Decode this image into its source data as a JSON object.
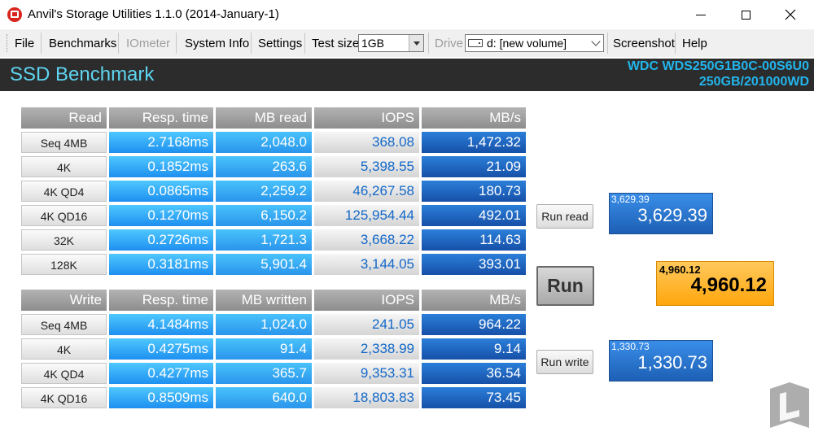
{
  "window": {
    "title": "Anvil's Storage Utilities 1.1.0 (2014-January-1)"
  },
  "menu": {
    "file": "File",
    "benchmarks": "Benchmarks",
    "iometer": "IOmeter",
    "system_info": "System Info",
    "settings": "Settings",
    "test_size_label": "Test size",
    "test_size_value": "1GB",
    "drive_label": "Drive",
    "drive_value": "d: [new volume]",
    "screenshot": "Screenshot",
    "help": "Help"
  },
  "header": {
    "title": "SSD Benchmark",
    "drive_model": "WDC WDS250G1B0C-00S6U0",
    "drive_size": "250GB/201000WD"
  },
  "read_table": {
    "headers": [
      "Read",
      "Resp. time",
      "MB read",
      "IOPS",
      "MB/s"
    ],
    "rows": [
      {
        "label": "Seq 4MB",
        "resp": "2.7168ms",
        "mb": "2,048.0",
        "iops": "368.08",
        "mbs": "1,472.32"
      },
      {
        "label": "4K",
        "resp": "0.1852ms",
        "mb": "263.6",
        "iops": "5,398.55",
        "mbs": "21.09"
      },
      {
        "label": "4K QD4",
        "resp": "0.0865ms",
        "mb": "2,259.2",
        "iops": "46,267.58",
        "mbs": "180.73"
      },
      {
        "label": "4K QD16",
        "resp": "0.1270ms",
        "mb": "6,150.2",
        "iops": "125,954.44",
        "mbs": "492.01"
      },
      {
        "label": "32K",
        "resp": "0.2726ms",
        "mb": "1,721.3",
        "iops": "3,668.22",
        "mbs": "114.63"
      },
      {
        "label": "128K",
        "resp": "0.3181ms",
        "mb": "5,901.4",
        "iops": "3,144.05",
        "mbs": "393.01"
      }
    ]
  },
  "write_table": {
    "headers": [
      "Write",
      "Resp. time",
      "MB written",
      "IOPS",
      "MB/s"
    ],
    "rows": [
      {
        "label": "Seq 4MB",
        "resp": "4.1484ms",
        "mb": "1,024.0",
        "iops": "241.05",
        "mbs": "964.22"
      },
      {
        "label": "4K",
        "resp": "0.4275ms",
        "mb": "91.4",
        "iops": "2,338.99",
        "mbs": "9.14"
      },
      {
        "label": "4K QD4",
        "resp": "0.4277ms",
        "mb": "365.7",
        "iops": "9,353.31",
        "mbs": "36.54"
      },
      {
        "label": "4K QD16",
        "resp": "0.8509ms",
        "mb": "640.0",
        "iops": "18,803.83",
        "mbs": "73.45"
      }
    ]
  },
  "buttons": {
    "run_read": "Run read",
    "run": "Run",
    "run_write": "Run write"
  },
  "scores": {
    "read_small": "3,629.39",
    "read_big": "3,629.39",
    "total_small": "4,960.12",
    "total_big": "4,960.12",
    "write_small": "1,330.73",
    "write_big": "1,330.73"
  },
  "icons": {
    "app": "app-icon",
    "minimize": "minimize-icon",
    "maximize": "maximize-icon",
    "close": "close-icon",
    "drive": "drive-icon",
    "watermark": "legit-reviews-logo"
  },
  "colors": {
    "header_bg": "#2c2c2c",
    "header_title": "#5fd4f0",
    "drive_info": "#22b5ec",
    "resp_cell": "#1e8ff0",
    "mbs_cell": "#1650a8",
    "total_score": "#ffa60c"
  }
}
